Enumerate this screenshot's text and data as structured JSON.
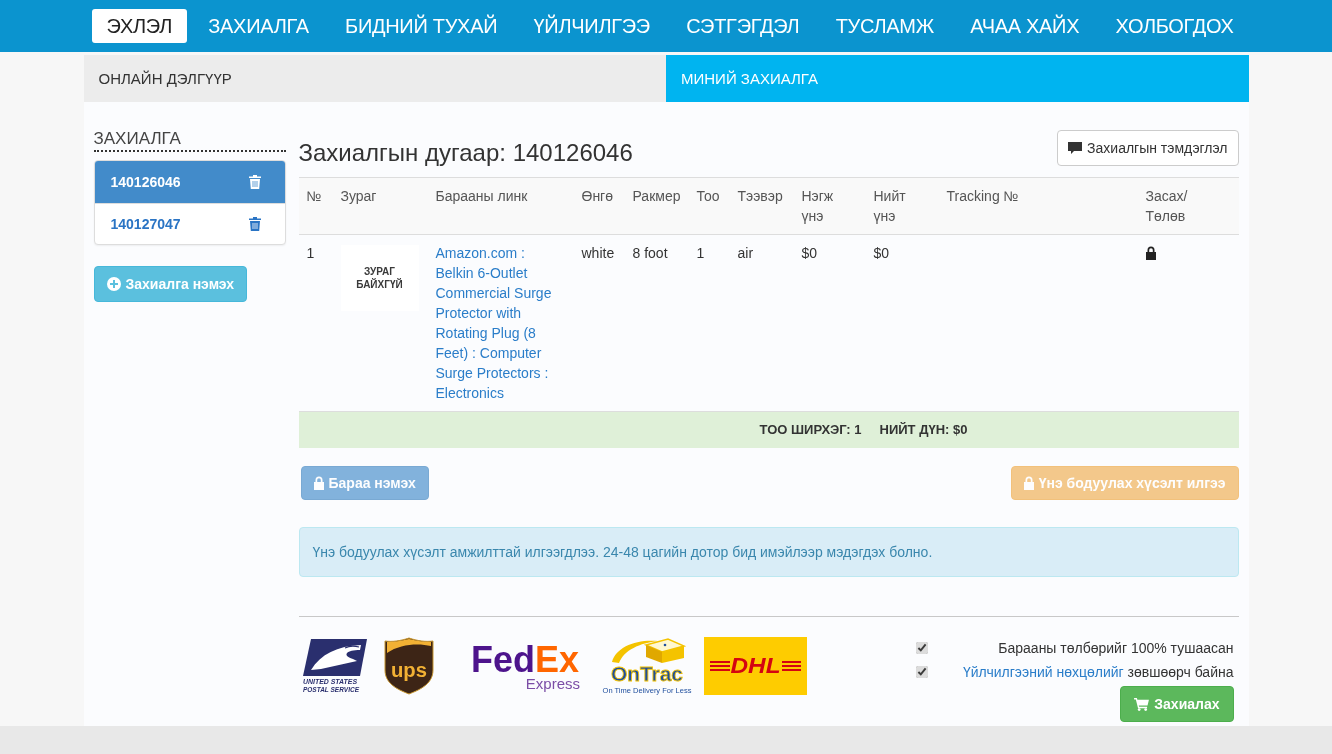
{
  "nav": {
    "items": [
      {
        "label": "ЭХЛЭЛ",
        "selected": true
      },
      {
        "label": "ЗАХИАЛГА",
        "selected": false
      },
      {
        "label": "БИДНИЙ ТУХАЙ",
        "selected": false
      },
      {
        "label": "ҮЙЛЧИЛГЭЭ",
        "selected": false
      },
      {
        "label": "СЭТГЭГДЭЛ",
        "selected": false
      },
      {
        "label": "ТУСЛАМЖ",
        "selected": false
      },
      {
        "label": "АЧАА ХАЙХ",
        "selected": false
      },
      {
        "label": "ХОЛБОГДОХ",
        "selected": false
      }
    ]
  },
  "tabs": [
    {
      "label": "ОНЛАЙН ДЭЛГҮҮР",
      "selected": false
    },
    {
      "label": "МИНИЙ ЗАХИАЛГА",
      "selected": true
    }
  ],
  "sidebar": {
    "title": "ЗАХИАЛГА",
    "orders": [
      {
        "number": "140126046",
        "selected": true
      },
      {
        "number": "140127047",
        "selected": false
      }
    ],
    "add_button": "Захиалга нэмэх"
  },
  "order": {
    "title": "Захиалгын дугаар: 140126046",
    "note_button": "Захиалгын тэмдэглэл",
    "table": {
      "columns": [
        "№",
        "Зураг",
        "Барааны линк",
        "Өнгө",
        "Ракмер",
        "Тоо",
        "Тээвэр",
        "Нэгж үнэ",
        "Нийт үнэ",
        "Tracking №",
        "Засах/Төлөв"
      ],
      "rows": [
        {
          "number": "1",
          "image_text": "ЗУРАГ БАЙХГҮЙ",
          "link": "Amazon.com : Belkin 6-Outlet Commercial Surge Protector with Rotating Plug (8 Feet) : Computer Surge Protectors : Electronics",
          "color_name": "white",
          "size": "8 foot",
          "quantity": "1",
          "shipping": "air",
          "unit_price": "$0",
          "total_price": "$0",
          "locked": true
        }
      ],
      "summary": [
        "ТОО ШИРХЭГ: 1",
        "НИЙТ ДҮН: $0"
      ]
    },
    "actions": [
      {
        "label": "Бараа нэмэх",
        "kind": "primary",
        "disabled": true
      },
      {
        "label": "Үнэ бодуулах хүсэлт илгээ",
        "kind": "warning",
        "disabled": true
      }
    ],
    "alert": "Үнэ бодуулах хүсэлт амжилттай илгээгдлээ. 24-48 цагийн дотор бид имэйлээр мэдэгдэх болно."
  },
  "carriers": [
    {
      "kind": "usps",
      "texts": [
        "UNITED STATES",
        "POSTAL SERVICE"
      ]
    },
    {
      "kind": "ups",
      "texts": [
        "ups"
      ]
    },
    {
      "kind": "fedex",
      "texts": [
        "Fed",
        "Ex",
        "Express"
      ]
    },
    {
      "kind": "ontrac",
      "texts": [
        "OnTrac",
        "On Time Delivery For Less"
      ]
    },
    {
      "kind": "dhl",
      "texts": [
        "DHL"
      ]
    }
  ],
  "agreements": [
    {
      "label": "Барааны төлбөрийг 100% тушаасан",
      "checked": true
    },
    {
      "link": "Үйлчилгээний нөхцөлийг",
      "label": "зөвшөөрч байна",
      "checked": true
    }
  ],
  "submit_button": "Захиалах"
}
